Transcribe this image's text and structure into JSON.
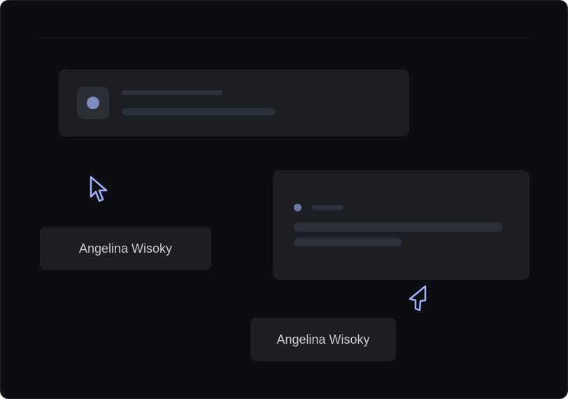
{
  "colors": {
    "background": "#0b0d11",
    "card": "#1b1e23",
    "placeholder_bar": "#2a313b",
    "accent": "#7f8cbf",
    "cursor_stroke": "#9fb4ff",
    "text": "#c9ccd2"
  },
  "top_card": {
    "avatar_icon": "avatar-dot-icon"
  },
  "right_card": {
    "status_icon": "status-dot-icon"
  },
  "tags": [
    {
      "label": "Angelina Wisoky"
    },
    {
      "label": "Angelina Wisoky"
    }
  ],
  "cursors": [
    {
      "icon": "pointer-cursor-icon"
    },
    {
      "icon": "pointer-cursor-icon"
    }
  ]
}
